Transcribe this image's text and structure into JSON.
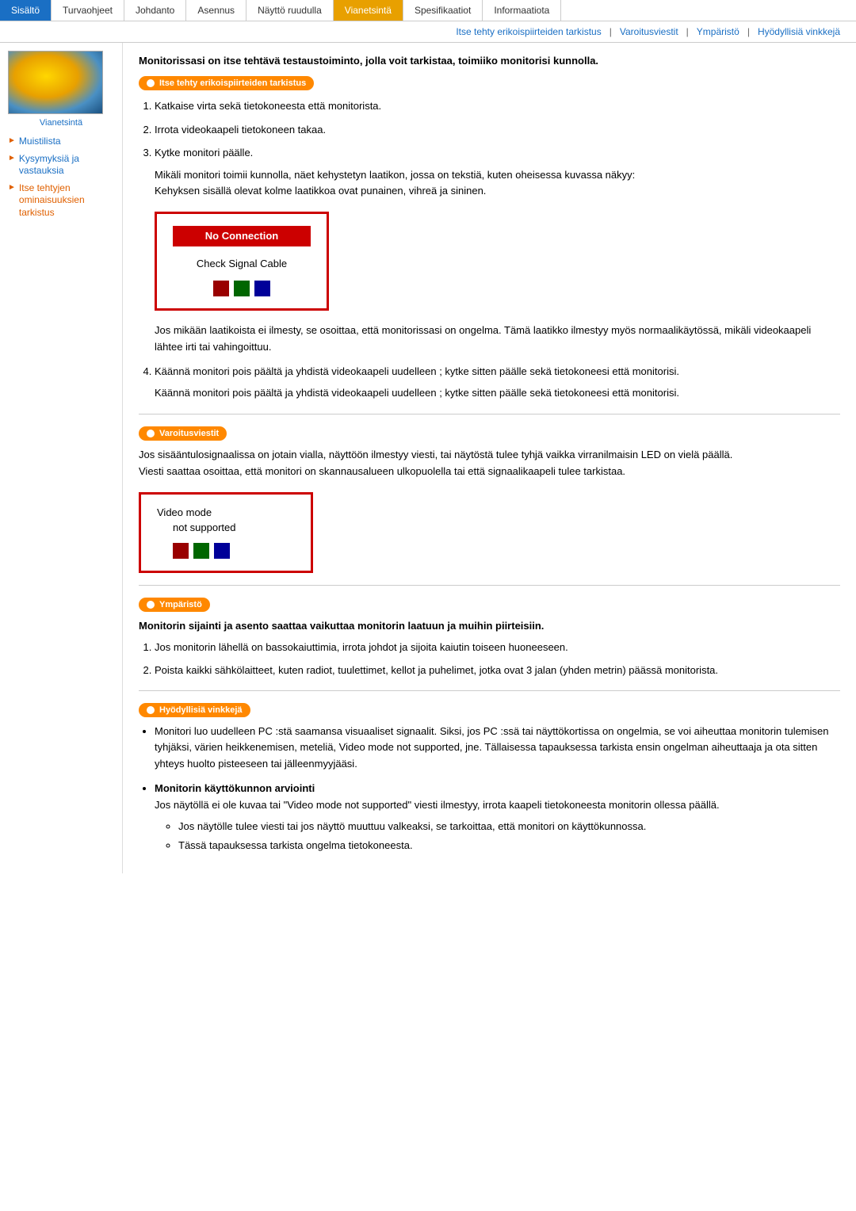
{
  "nav": {
    "items": [
      {
        "label": "Sisältö",
        "active": false,
        "highlight": false
      },
      {
        "label": "Turvaohjeet",
        "active": false,
        "highlight": false
      },
      {
        "label": "Johdanto",
        "active": false,
        "highlight": false
      },
      {
        "label": "Asennus",
        "active": false,
        "highlight": false
      },
      {
        "label": "Näyttö ruudulla",
        "active": false,
        "highlight": false
      },
      {
        "label": "Vianetsintä",
        "active": false,
        "highlight": true
      },
      {
        "label": "Spesifikaatiot",
        "active": false,
        "highlight": false
      },
      {
        "label": "Informaatiota",
        "active": false,
        "highlight": false
      }
    ]
  },
  "subnav": {
    "links": [
      "Itse tehty erikoispiirteiden tarkistus",
      "Varoitusviestit",
      "Ympäristö",
      "Hyödyllisiä vinkkejä"
    ]
  },
  "sidebar": {
    "label": "Vianetsintä",
    "menu": [
      {
        "label": "Muistilista",
        "active": false
      },
      {
        "label": "Kysymyksiä ja vastauksia",
        "active": false
      },
      {
        "label": "Itse tehtyjen ominaisuuksien tarkistus",
        "active": true
      }
    ]
  },
  "main": {
    "intro": "Monitorissasi on itse tehtävä testaustoiminto, jolla voit tarkistaa, toimiiko monitorisi kunnolla.",
    "section1_header": "Itse tehty erikoispiirteiden tarkistus",
    "steps": [
      "Katkaise virta sekä tietokoneesta että monitorista.",
      "Irrota videokaapeli tietokoneen takaa.",
      "Kytke monitori päälle."
    ],
    "para1": "Mikäli monitori toimii kunnolla, näet kehystetyn laatikon, jossa on tekstiä, kuten oheisessa kuvassa näkyy:\nKehyksen sisällä olevat kolme laatikkoa ovat punainen, vihreä ja sininen.",
    "monitor_box": {
      "title": "No Connection",
      "subtitle": "Check Signal Cable"
    },
    "para2": "Jos mikään laatikoista ei ilmesty, se osoittaa, että monitorissasi on ongelma. Tämä laatikko ilmestyy myös normaalikäytössä, mikäli videokaapeli lähtee irti tai vahingoittuu.",
    "step4": "Käännä monitori pois päältä ja yhdistä videokaapeli uudelleen ; kytke sitten päälle sekä tietokoneesi että monitorisi.",
    "step4_repeat": "Käännä monitori pois päältä ja yhdistä videokaapeli uudelleen ; kytke sitten päälle sekä tietokoneesi että monitorisi.",
    "section2_header": "Varoitusviestit",
    "section2_para1": "Jos sisääntulosignaalissa on jotain vialla, näyttöön ilmestyy viesti, tai näytöstä tulee tyhjä vaikka virranilmaisin LED on vielä päällä.\nViesti saattaa osoittaa, että monitori on skannausalueen ulkopuolella tai että signaalikaapeli tulee tarkistaa.",
    "video_box": {
      "line1": "Video mode",
      "line2": "not supported"
    },
    "section3_header": "Ympäristö",
    "section3_bold": "Monitorin sijainti ja asento saattaa vaikuttaa monitorin laatuun ja muihin piirteisiin.",
    "section3_steps": [
      "Jos monitorin lähellä on bassokaiuttimia, irrota johdot ja sijoita kaiutin toiseen huoneeseen.",
      "Poista kaikki sähkölaitteet, kuten radiot, tuulettimet, kellot ja puhelimet, jotka ovat 3 jalan (yhden metrin) päässä monitorista."
    ],
    "section4_header": "Hyödyllisiä vinkkejä",
    "section4_bullets": [
      "Monitori luo uudelleen PC :stä saamansa visuaaliset signaalit. Siksi, jos PC :ssä tai näyttökortissa on ongelmia, se voi aiheuttaa monitorin tulemisen tyhjäksi, värien heikkenemisen, meteliä, Video mode not supported, jne. Tällaisessa tapauksessa tarkista ensin ongelman aiheuttaaja ja ota sitten yhteys huolto pisteeseen tai jälleenmyyjääsi.",
      ""
    ],
    "section4_bold_item": "Monitorin käyttökunnon arviointi",
    "section4_bold_para": "Jos näytöllä ei ole kuvaa tai \"Video mode not supported\" viesti ilmestyy, irrota kaapeli tietokoneesta monitorin ollessa päällä.",
    "section4_subbullets": [
      "Jos näytölle tulee viesti tai jos näyttö muuttuu valkeaksi, se tarkoittaa, että monitori on käyttökunnossa.",
      "Tässä tapauksessa tarkista ongelma tietokoneesta."
    ]
  }
}
